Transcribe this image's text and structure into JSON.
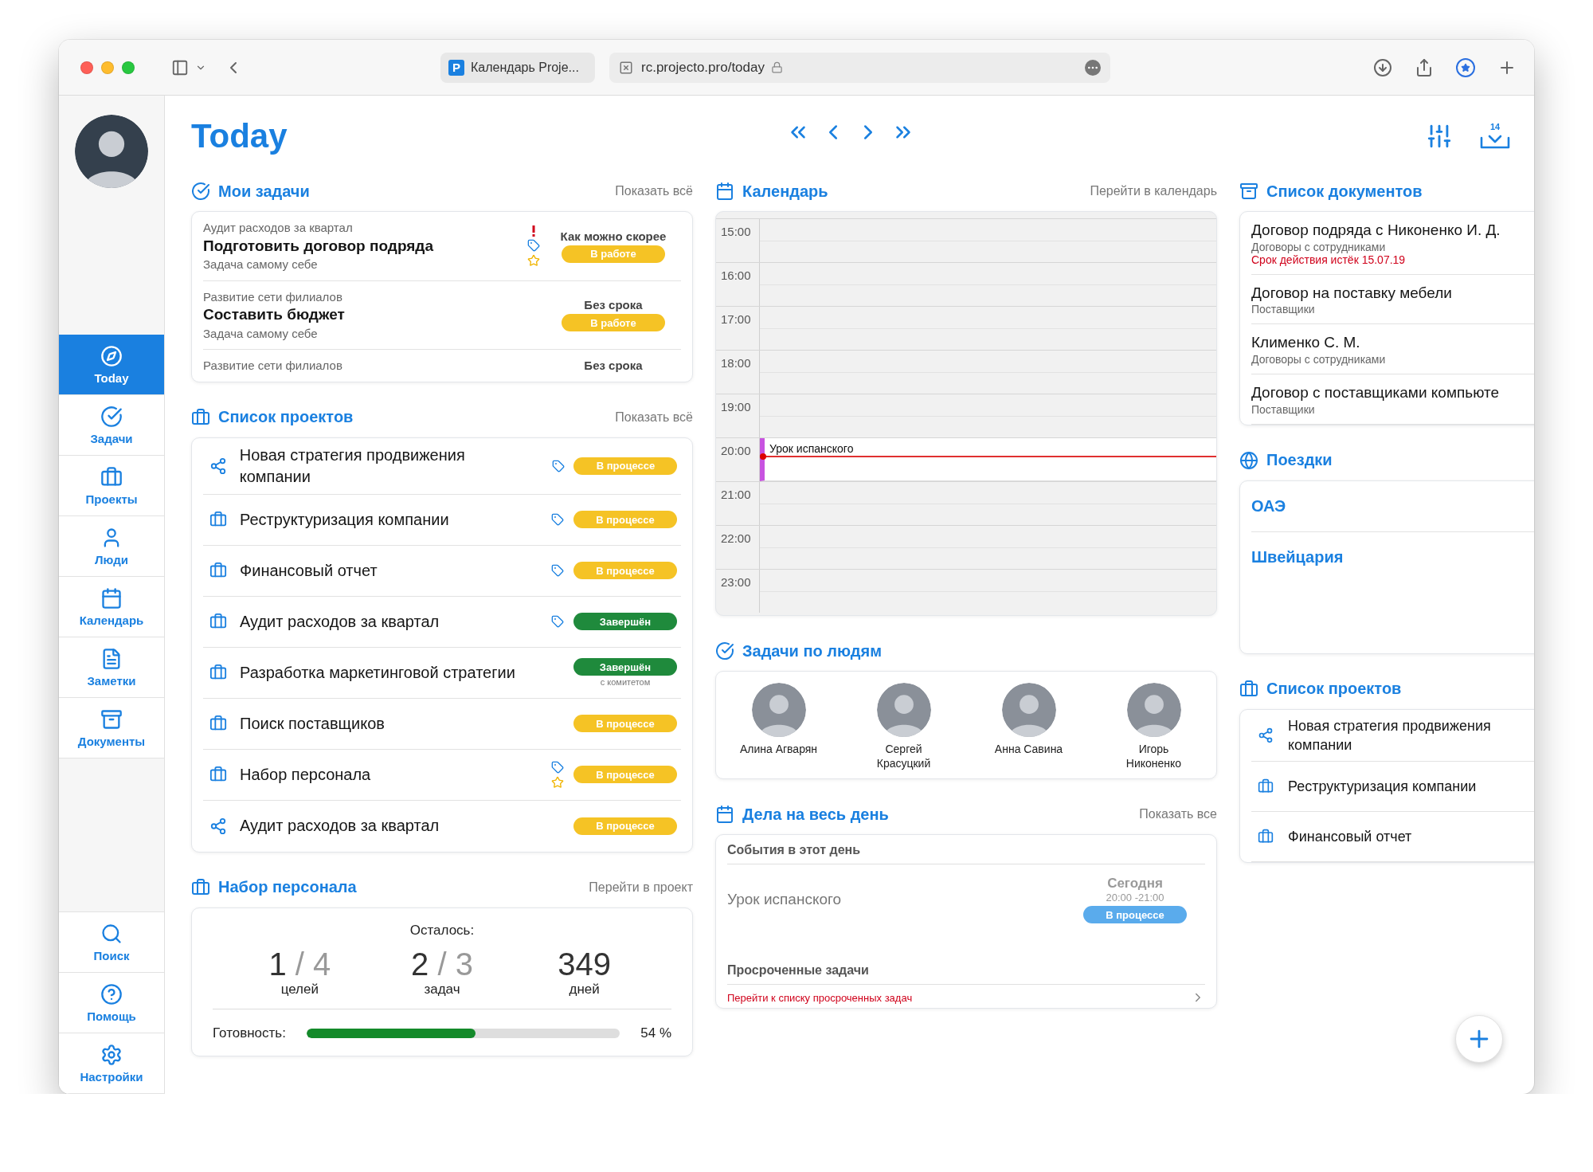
{
  "browser": {
    "tab_icon_text": "P",
    "tab_title": "Календарь Proje...",
    "address": "rc.projecto.pro/today"
  },
  "sidebar": {
    "items": [
      {
        "label": "Today",
        "selected": true
      },
      {
        "label": "Задачи",
        "selected": false
      },
      {
        "label": "Проекты",
        "selected": false
      },
      {
        "label": "Люди",
        "selected": false
      },
      {
        "label": "Календарь",
        "selected": false
      },
      {
        "label": "Заметки",
        "selected": false
      },
      {
        "label": "Документы",
        "selected": false
      }
    ],
    "bottom_items": [
      {
        "label": "Поиск"
      },
      {
        "label": "Помощь"
      },
      {
        "label": "Настройки"
      }
    ]
  },
  "header": {
    "title": "Today",
    "inbox_count": "14"
  },
  "my_tasks": {
    "title": "Мои задачи",
    "link": "Показать всё",
    "items": [
      {
        "project": "Аудит расходов за квартал",
        "title": "Подготовить договор подряда",
        "subtitle": "Задача самому себе",
        "urgent": true,
        "tagged": true,
        "starred": true,
        "deadline": "Как можно скорее",
        "status": {
          "label": "В работе",
          "color": "#f5c325"
        }
      },
      {
        "project": "Развитие сети филиалов",
        "title": "Составить бюджет",
        "subtitle": "Задача самому себе",
        "urgent": false,
        "tagged": false,
        "starred": false,
        "deadline": "Без срока",
        "status": {
          "label": "В работе",
          "color": "#f5c325"
        }
      },
      {
        "project": "Развитие сети филиалов",
        "urgent": false,
        "tagged": false,
        "starred": false,
        "deadline": "Без срока"
      }
    ]
  },
  "projects": {
    "title": "Список проектов",
    "link": "Показать всё",
    "items": [
      {
        "kind": "shared",
        "name": "Новая стратегия продвижения компании",
        "tagged": true,
        "starred": false,
        "status": {
          "label": "В процессе",
          "color": "#f5c325"
        }
      },
      {
        "kind": "project",
        "name": "Реструктуризация компании",
        "tagged": true,
        "starred": false,
        "status": {
          "label": "В процессе",
          "color": "#f5c325"
        }
      },
      {
        "kind": "project",
        "name": "Финансовый отчет",
        "tagged": true,
        "starred": false,
        "status": {
          "label": "В процессе",
          "color": "#f5c325"
        }
      },
      {
        "kind": "project",
        "name": "Аудит расходов за квартал",
        "tagged": true,
        "starred": false,
        "status": {
          "label": "Завершён",
          "color": "#1f8a3c"
        }
      },
      {
        "kind": "project",
        "name": "Разработка маркетинговой стратегии",
        "tagged": false,
        "starred": false,
        "status": {
          "label": "Завершён",
          "color": "#1f8a3c"
        },
        "note": "с комитетом"
      },
      {
        "kind": "project",
        "name": "Поиск поставщиков",
        "tagged": false,
        "starred": false,
        "status": {
          "label": "В процессе",
          "color": "#f5c325"
        }
      },
      {
        "kind": "project",
        "name": "Набор персонала",
        "tagged": true,
        "starred": true,
        "status": {
          "label": "В процессе",
          "color": "#f5c325"
        }
      },
      {
        "kind": "shared",
        "name": "Аудит расходов за квартал",
        "tagged": false,
        "starred": false,
        "status": {
          "label": "В процессе",
          "color": "#f5c325"
        }
      }
    ]
  },
  "recruiting": {
    "title": "Набор персонала",
    "link": "Перейти в проект",
    "remaining_label": "Осталось:",
    "stats": [
      {
        "done": "1",
        "total": "/ 4",
        "unit": "целей"
      },
      {
        "done": "2",
        "total": "/ 3",
        "unit": "задач"
      },
      {
        "done": "349",
        "unit": "дней"
      }
    ],
    "progress": {
      "label": "Готовность:",
      "level": 0.54,
      "reading": "54 %"
    }
  },
  "calendar": {
    "title": "Календарь",
    "link": "Перейти в календарь",
    "hours": [
      {
        "time": "15:00",
        "current": false
      },
      {
        "time": "16:00",
        "current": false
      },
      {
        "time": "17:00",
        "current": false
      },
      {
        "time": "18:00",
        "current": false
      },
      {
        "time": "19:00",
        "current": false
      },
      {
        "time": "20:00",
        "event": "Урок испанского",
        "current": true
      },
      {
        "time": "21:00",
        "current": false
      },
      {
        "time": "22:00",
        "current": false
      },
      {
        "time": "23:00",
        "current": false
      }
    ]
  },
  "people": {
    "title": "Задачи по людям",
    "items": [
      {
        "name": "Алина Агварян"
      },
      {
        "name": "Сергей Красуцкий"
      },
      {
        "name": "Анна Савина"
      },
      {
        "name": "Игорь Никоненко"
      }
    ]
  },
  "all_day": {
    "title": "Дела на весь день",
    "link": "Показать все",
    "events_heading": "События в этот день",
    "events": [
      {
        "title": "Урок испанского",
        "day": "Сегодня",
        "time": "20:00 -21:00",
        "status": {
          "label": "В процессе",
          "color": "#5aabec"
        }
      }
    ],
    "overdue_heading": "Просроченные задачи",
    "overdue_link": "Перейти к списку просроченных задач"
  },
  "documents": {
    "title": "Список документов",
    "items": [
      {
        "title": "Договор подряда с Никоненко И. Д.",
        "category": "Договоры с сотрудниками",
        "note": "Срок действия истёк 15.07.19"
      },
      {
        "title": "Договор на поставку мебели",
        "category": "Поставщики"
      },
      {
        "title": "Клименко С. М.",
        "category": "Договоры с сотрудниками"
      },
      {
        "title": "Договор с поставщиками компьюте",
        "category": "Поставщики"
      }
    ]
  },
  "trips": {
    "title": "Поездки",
    "items": [
      "ОАЭ",
      "Швейцария"
    ]
  },
  "side_projects": {
    "title": "Список проектов",
    "items": [
      {
        "kind": "shared",
        "name": "Новая стратегия продвижения компании"
      },
      {
        "kind": "project",
        "name": "Реструктуризация компании"
      },
      {
        "kind": "project",
        "name": "Финансовый отчет"
      }
    ]
  }
}
